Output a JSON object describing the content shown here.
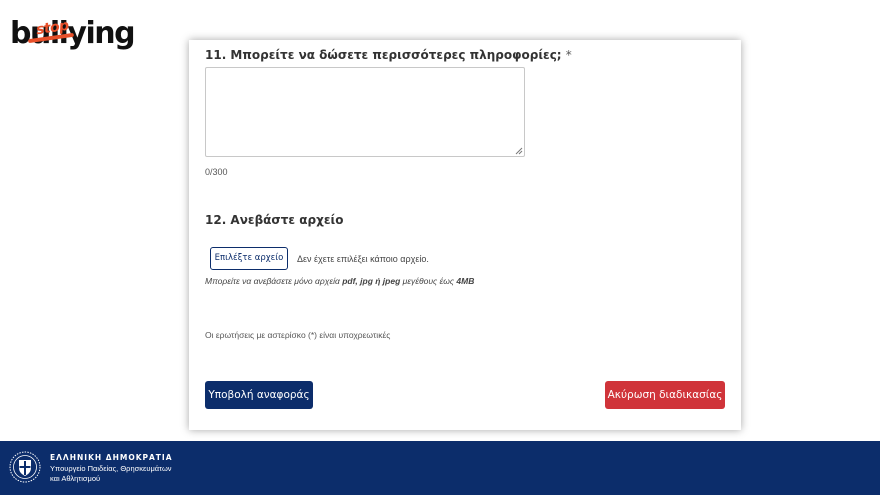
{
  "logo": {
    "main": "bullying",
    "overlay": "stop"
  },
  "form": {
    "q11": {
      "label": "11. Μπορείτε να δώσετε περισσότερες πληροφορίες;",
      "required_mark": "*",
      "value": "",
      "counter": "0/300"
    },
    "q12": {
      "label": "12. Ανεβάστε αρχείο",
      "button_label": "Επιλέξτε αρχείο",
      "status": "Δεν έχετε επιλέξει κάποιο αρχείο.",
      "hint_prefix": "Μπορείτε να ανεβάσετε μόνο αρχεία ",
      "hint_types": "pdf, jpg ή jpeg",
      "hint_middle": " μεγέθους έως ",
      "hint_size": "4MB"
    },
    "mandatory_note": "Οι ερωτήσεις με αστερίσκο (*) είναι υποχρεωτικές",
    "submit_label": "Υποβολή αναφοράς",
    "cancel_label": "Ακύρωση διαδικασίας"
  },
  "footer": {
    "title": "ΕΛΛΗΝΙΚΗ ΔΗΜΟΚΡΑΤΙΑ",
    "line1": "Υπουργείο Παιδείας, Θρησκευμάτων",
    "line2": "και Αθλητισμού"
  },
  "colors": {
    "primary": "#0c2d6b",
    "danger": "#d0343a",
    "logo_accent": "#e8502a"
  },
  "icons": {
    "emblem": "greek-republic-emblem-icon",
    "resize": "resize-grip-icon"
  }
}
